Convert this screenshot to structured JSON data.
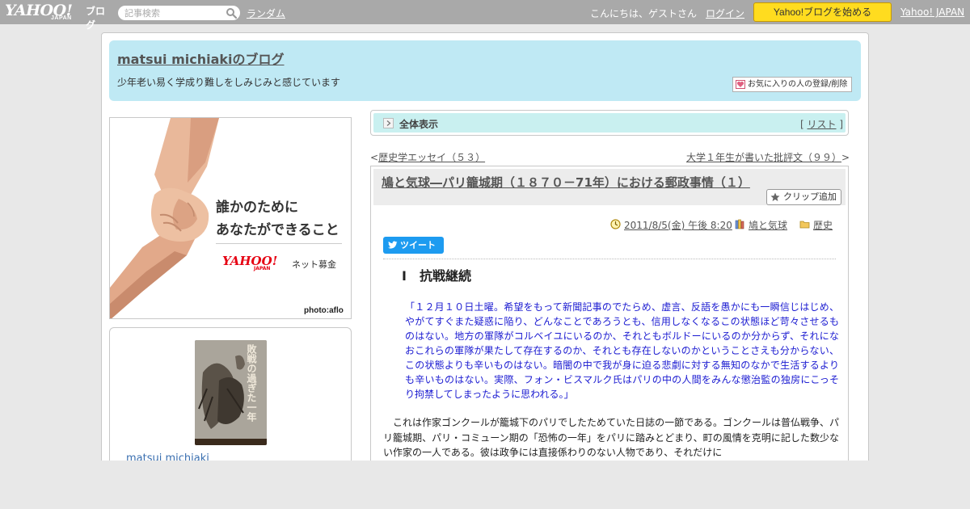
{
  "topbar": {
    "logo_yahoo": "YAHOO!",
    "logo_japan": "JAPAN",
    "logo_blog": "ブログ",
    "search_placeholder": "記事検索",
    "search_icon": "search-icon",
    "random_link": "ランダム",
    "greeting": "こんにちは、ゲストさん",
    "login_link": "ログイン",
    "start_button": "Yahoo!ブログを始める",
    "yahoo_japan_link": "Yahoo! JAPAN",
    "start_button_color": "#ffdc1f"
  },
  "header": {
    "blog_title": "matsui michiakiのブログ",
    "description": "少年老い易く学成り難しをしみじみと感じています",
    "favorite_button": "お気に入りの人の登録/削除",
    "background_color": "#bfe9f4"
  },
  "ad": {
    "line1": "誰かのために",
    "line2": "あなたができること",
    "logo_yahoo": "YAHOO!",
    "logo_japan": "JAPAN",
    "service": "ネット募金",
    "credit": "photo:aflo"
  },
  "profile": {
    "book_title": "敗戦の過ぎた一年",
    "name": "matsui michiaki"
  },
  "allview": {
    "label": "全体表示",
    "list_open": "[",
    "list_link": "リスト",
    "list_close": "]",
    "background_color": "#c9f0f0"
  },
  "nav": {
    "prev_mark": "<",
    "prev": "歴史学エッセイ（５３）",
    "next": "大学１年生が書いた批評文（９９）",
    "next_mark": ">"
  },
  "article": {
    "title": "鳩と気球―パリ籠城期（１８７０－71年）における郵政事情（１）",
    "clip_button": "クリップ追加",
    "date": "2011/8/5(金) 午後 8:20",
    "tag": "鳩と気球",
    "category": "歴史",
    "tweet_button": "ツイート",
    "section_heading": "Ⅰ　抗戦継続",
    "quote": "「１２月１０日土曜。希望をもって新聞記事のでたらめ、虚言、反語を愚かにも一瞬信じはじめ、やがてすぐまた疑惑に陥り、どんなことであろうとも、信用しなくなるこの状態ほど苛々させるものはない。地方の軍隊がコルベイユにいるのか、それともボルドーにいるのか分からず、それになおこれらの軍隊が果たして存在するのか、それとも存在しないのかということさえも分からない、この状態よりも辛いものはない。暗闇の中で我が身に迫る悲劇に対する無知のなかで生活するよりも辛いものはない。実際、フォン・ビスマルク氏はパリの中の人間をみんな懲治監の独房にこっそり拘禁してしまったように思われる。」",
    "quote_color": "#1b1bd1",
    "body": "これは作家ゴンクールが籠城下のパリでしたためていた日誌の一節である。ゴンクールは普仏戦争、パリ籠城期、パリ・コミューン期の「恐怖の一年」をパリに踏みとどまり、町の風情を克明に記した数少ない作家の一人である。彼は政争には直接係わりのない人物であり、それだけに"
  }
}
